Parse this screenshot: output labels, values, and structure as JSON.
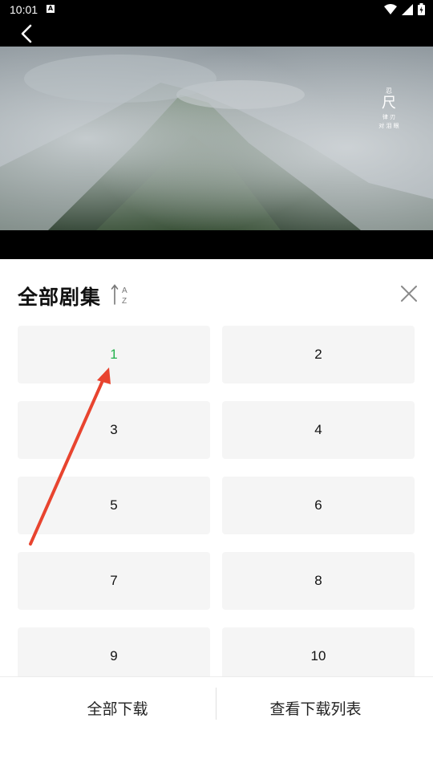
{
  "status": {
    "time": "10:01",
    "notification_icon": "A"
  },
  "video": {
    "watermark": [
      "忍",
      "尺",
      "律 刃",
      "对 泪 眼"
    ]
  },
  "panel": {
    "title": "全部剧集",
    "sort_icon_letters": [
      "A",
      "Z"
    ],
    "episodes": [
      {
        "label": "1",
        "active": true
      },
      {
        "label": "2",
        "active": false
      },
      {
        "label": "3",
        "active": false
      },
      {
        "label": "4",
        "active": false
      },
      {
        "label": "5",
        "active": false
      },
      {
        "label": "6",
        "active": false
      },
      {
        "label": "7",
        "active": false
      },
      {
        "label": "8",
        "active": false
      },
      {
        "label": "9",
        "active": false
      },
      {
        "label": "10",
        "active": false
      }
    ],
    "active_color": "#22b14c"
  },
  "bottom": {
    "download_all": "全部下载",
    "view_download_list": "查看下载列表"
  },
  "annotation_color": "#e8442f"
}
